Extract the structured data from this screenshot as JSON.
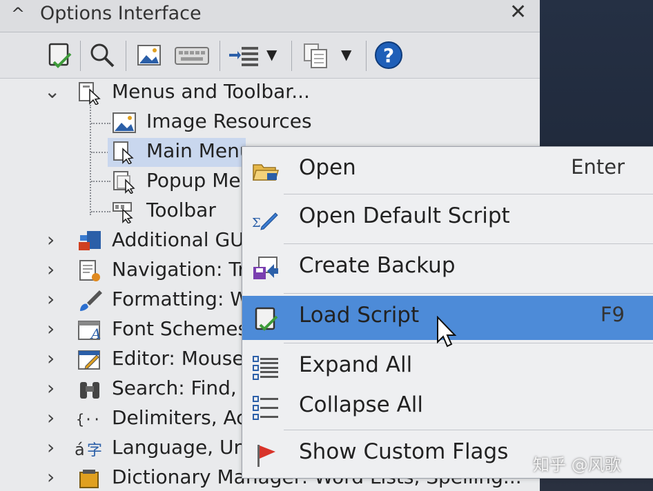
{
  "window": {
    "title": "Options Interface",
    "close_label": "✕",
    "collapse_glyph": "^"
  },
  "toolbar": {
    "buttons": [
      "load-script-icon",
      "search-icon",
      "image-icon",
      "keyboard-icon",
      "indent-icon",
      "copy-icon",
      "help-icon"
    ]
  },
  "tree": {
    "root": {
      "label": "Menus and Toolbar...",
      "expanded": true
    },
    "children": [
      {
        "label": "Image Resources"
      },
      {
        "label": "Main Menu",
        "selected": true
      },
      {
        "label": "Popup Men"
      },
      {
        "label": "Toolbar"
      }
    ],
    "items": [
      {
        "label": "Additional GUI"
      },
      {
        "label": "Navigation: Tr"
      },
      {
        "label": "Formatting: W"
      },
      {
        "label": "Font Schemes"
      },
      {
        "label": "Editor: Mouse,"
      },
      {
        "label": "Search: Find, I"
      },
      {
        "label": "Delimiters, Acti"
      },
      {
        "label": "Language, Uni"
      },
      {
        "label": "Dictionary Manager: Word Lists, Spelling..."
      }
    ]
  },
  "context_menu": {
    "items": [
      {
        "label": "Open",
        "shortcut": "Enter",
        "icon": "folder-open-icon"
      },
      {
        "label": "Open Default Script",
        "shortcut": "",
        "icon": "script-icon"
      },
      {
        "label": "Create Backup",
        "shortcut": "",
        "icon": "backup-icon"
      },
      {
        "label": "Load Script",
        "shortcut": "F9",
        "icon": "load-script-icon",
        "highlighted": true
      },
      {
        "label": "Expand All",
        "shortcut": "",
        "icon": "expand-all-icon"
      },
      {
        "label": "Collapse All",
        "shortcut": "",
        "icon": "collapse-all-icon"
      },
      {
        "label": "Show Custom Flags",
        "shortcut": "",
        "icon": "flag-icon"
      }
    ]
  },
  "watermark": "知乎 @风歌",
  "colors": {
    "highlight": "#4d8bd8",
    "selection": "#c9d7ee",
    "panel": "#e9eaec"
  }
}
